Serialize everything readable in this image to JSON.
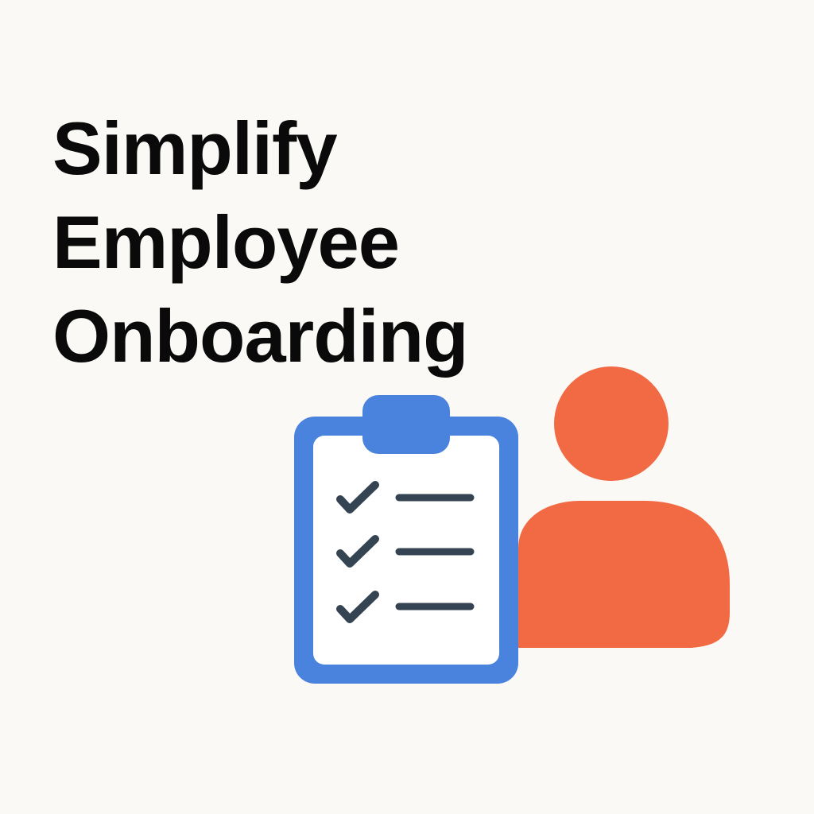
{
  "headline": {
    "line1": "Simplify",
    "line2": "Employee",
    "line3": "Onboarding"
  },
  "colors": {
    "background": "#fbf9f5",
    "text": "#0a0a0a",
    "clipboard": "#4a83de",
    "clipboard_paper": "#ffffff",
    "checklist": "#344452",
    "person": "#f26a44"
  },
  "icons": {
    "clipboard": "clipboard-checklist-icon",
    "person": "person-icon",
    "check": "checkmark-icon"
  },
  "checklist": {
    "items_checked": 3,
    "items_total": 3
  }
}
